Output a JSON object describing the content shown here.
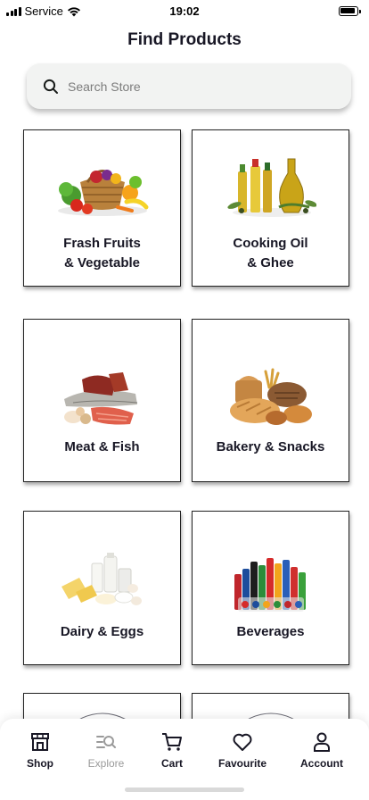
{
  "status_bar": {
    "carrier": "Service",
    "time": "19:02"
  },
  "header": {
    "title": "Find Products"
  },
  "search": {
    "placeholder": "Search Store",
    "icon": "search-icon"
  },
  "categories": [
    {
      "line1": "Frash Fruits",
      "line2": "& Vegetable",
      "icon": "fruits-vegetables-image"
    },
    {
      "line1": "Cooking Oil",
      "line2": "& Ghee",
      "icon": "cooking-oil-image"
    },
    {
      "line1": "Meat & Fish",
      "line2": "",
      "icon": "meat-fish-image"
    },
    {
      "line1": "Bakery & Snacks",
      "line2": "",
      "icon": "bakery-image"
    },
    {
      "line1": "Dairy & Eggs",
      "line2": "",
      "icon": "dairy-eggs-image"
    },
    {
      "line1": "Beverages",
      "line2": "",
      "icon": "beverages-image"
    }
  ],
  "tabs": [
    {
      "label": "Shop",
      "icon": "shop-icon",
      "active": true
    },
    {
      "label": "Explore",
      "icon": "explore-icon",
      "active": false
    },
    {
      "label": "Cart",
      "icon": "cart-icon",
      "active": true
    },
    {
      "label": "Favourite",
      "icon": "heart-icon",
      "active": true
    },
    {
      "label": "Account",
      "icon": "account-icon",
      "active": true
    }
  ]
}
